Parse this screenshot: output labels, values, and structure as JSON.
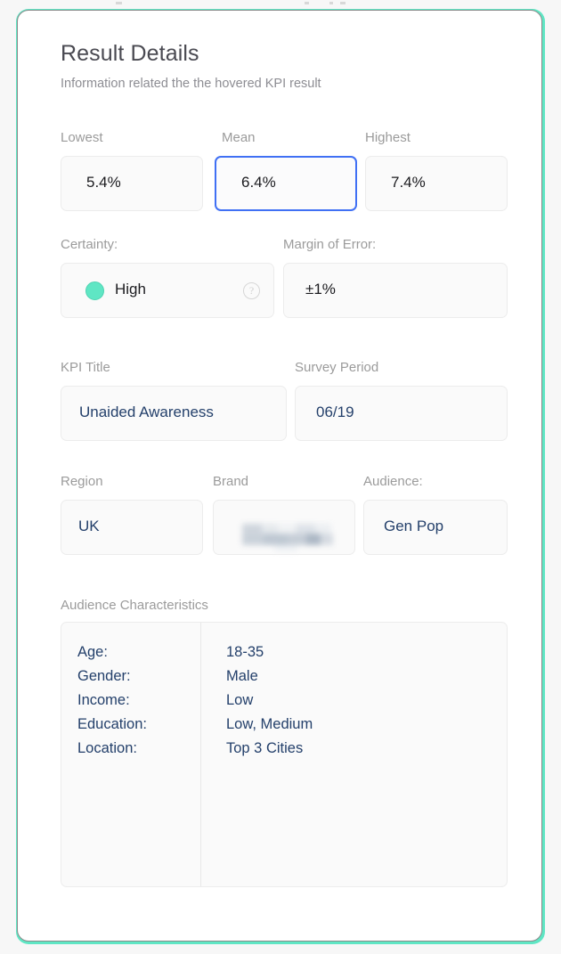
{
  "card": {
    "title": "Result Details",
    "subtitle": "Information related the the hovered KPI result",
    "accent_color": "#5fe6c4",
    "highlight_color": "#4070f4"
  },
  "stats": [
    {
      "label": "Lowest",
      "value": "5.4%",
      "highlighted": false
    },
    {
      "label": "Mean",
      "value": "6.4%",
      "highlighted": true
    },
    {
      "label": "Highest",
      "value": "7.4%",
      "highlighted": false
    }
  ],
  "certainty": {
    "label": "Certainty:",
    "value": "High",
    "status_color": "#5fe6c4",
    "help_icon": "question-mark-icon",
    "help_glyph": "?"
  },
  "margin_of_error": {
    "label": "Margin of Error:",
    "value": "±1%"
  },
  "kpi_title": {
    "label": "KPI Title",
    "value": "Unaided Awareness"
  },
  "survey_period": {
    "label": "Survey Period",
    "value": "06/19"
  },
  "region": {
    "label": "Region",
    "value": "UK"
  },
  "brand": {
    "label": "Brand",
    "value": "",
    "redacted": true
  },
  "audience": {
    "label": "Audience:",
    "value": "Gen Pop"
  },
  "audience_characteristics": {
    "label": "Audience Characteristics",
    "rows": [
      {
        "key": "Age:",
        "value": "18-35"
      },
      {
        "key": "Gender:",
        "value": "Male"
      },
      {
        "key": "Income:",
        "value": "Low"
      },
      {
        "key": "Education:",
        "value": "Low, Medium"
      },
      {
        "key": "Location:",
        "value": "Top 3 Cities"
      }
    ]
  }
}
